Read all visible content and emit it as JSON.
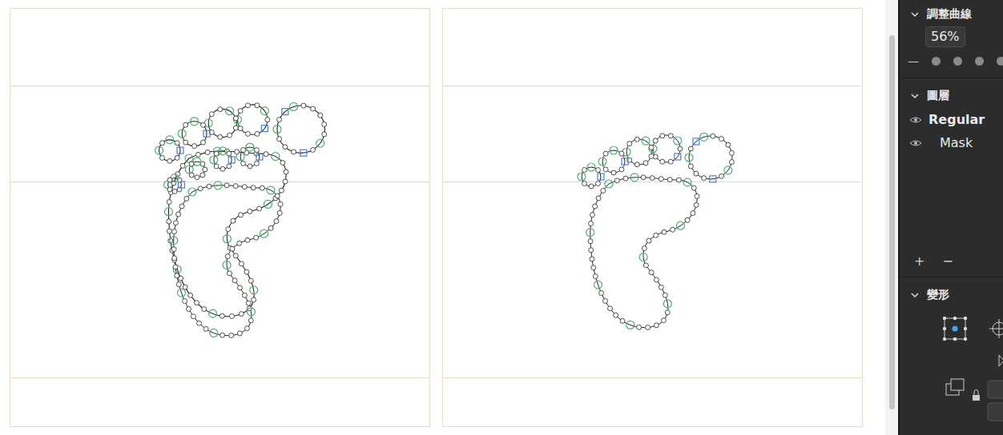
{
  "curve_section": {
    "title": "調整曲線",
    "value": "56%",
    "minus": "—"
  },
  "layers_section": {
    "title": "圖層",
    "layers": [
      {
        "name": "Regular",
        "kind": "master"
      },
      {
        "name": "Mask",
        "kind": "mask"
      }
    ],
    "add": "+",
    "remove": "−"
  },
  "transform_section": {
    "title": "變形"
  }
}
